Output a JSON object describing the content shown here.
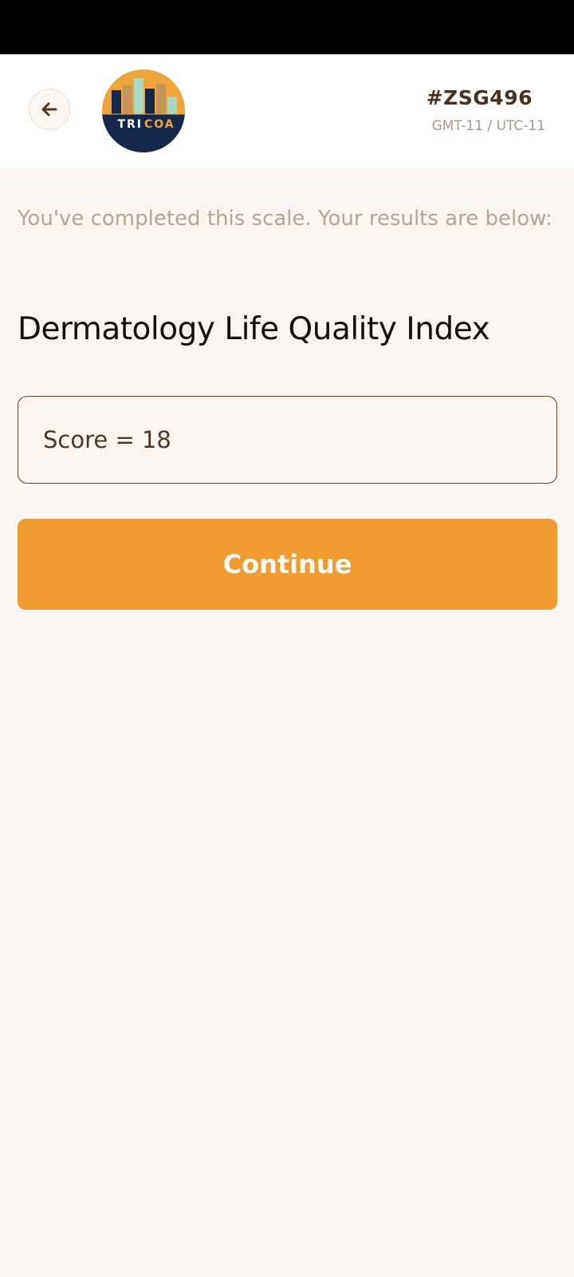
{
  "header": {
    "back_icon": "arrow-left-icon",
    "logo_text_tri": "TRI",
    "logo_text_coa": "COA",
    "session_code": "#ZSG496",
    "timezone": "GMT-11 / UTC-11"
  },
  "main": {
    "completed_message": "You've completed this scale. Your results are below:",
    "scale_title": "Dermatology Life Quality Index",
    "score_text": "Score = 18",
    "continue_label": "Continue"
  },
  "colors": {
    "accent": "#f19b33",
    "background": "#faf5f0",
    "logo_navy": "#15284a",
    "text_brown": "#4a3221"
  }
}
